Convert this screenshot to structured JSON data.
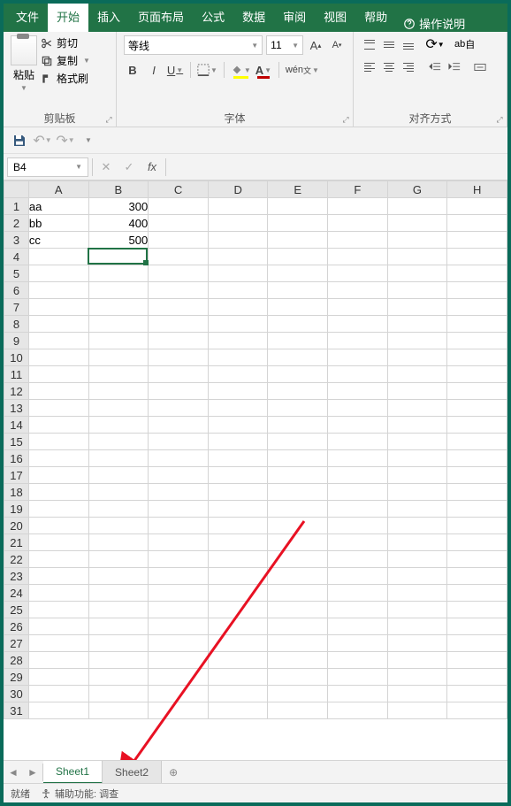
{
  "tabs": {
    "file": "文件",
    "home": "开始",
    "insert": "插入",
    "layout": "页面布局",
    "formula": "公式",
    "data": "数据",
    "review": "审阅",
    "view": "视图",
    "help": "帮助",
    "tell": "操作说明"
  },
  "ribbon": {
    "clipboard": {
      "label": "剪贴板",
      "paste": "粘贴",
      "cut": "剪切",
      "copy": "复制",
      "format": "格式刷"
    },
    "font": {
      "label": "字体",
      "name": "等线",
      "size": "11",
      "bold": "B",
      "italic": "I",
      "underline": "U"
    },
    "align": {
      "label": "对齐方式",
      "wrap": "自"
    }
  },
  "namebox": "B4",
  "columns": [
    "A",
    "B",
    "C",
    "D",
    "E",
    "F",
    "G",
    "H"
  ],
  "rows": 31,
  "cells": {
    "A1": "aa",
    "B1": "300",
    "A2": "bb",
    "B2": "400",
    "A3": "cc",
    "B3": "500"
  },
  "selectedCell": "B4",
  "sheets": {
    "s1": "Sheet1",
    "s2": "Sheet2"
  },
  "status": {
    "ready": "就绪",
    "acc": "辅助功能: 调查"
  }
}
